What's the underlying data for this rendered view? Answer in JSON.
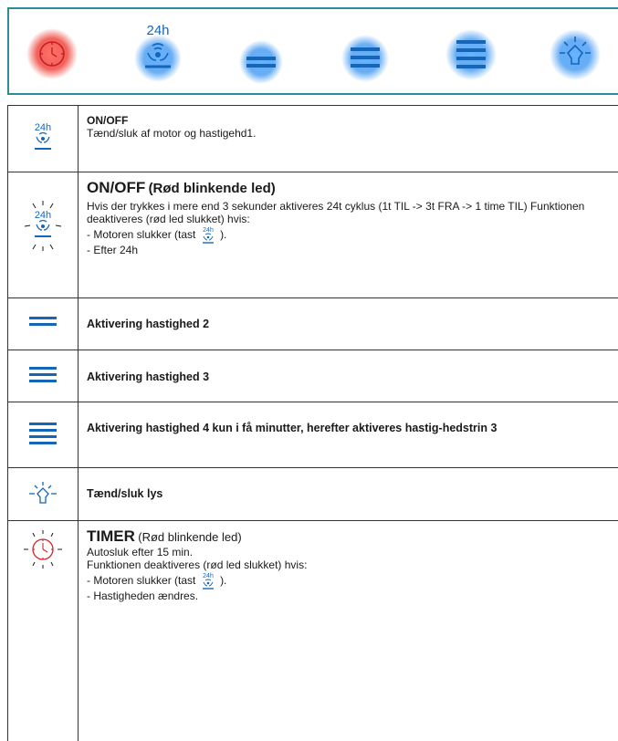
{
  "panel": {
    "buttons": [
      {
        "name": "timer-button",
        "icon": "timer-icon",
        "glow": "#e8352f"
      },
      {
        "name": "onoff-24h-button",
        "icon": "fan-24h-icon",
        "label": "24h",
        "glow": "#1e78e6"
      },
      {
        "name": "speed-2-button",
        "icon": "speed-2-bars-icon",
        "glow": "#1e78e6"
      },
      {
        "name": "speed-3-button",
        "icon": "speed-3-bars-icon",
        "glow": "#1e78e6"
      },
      {
        "name": "speed-4-button",
        "icon": "speed-4-bars-icon",
        "glow": "#1e78e6"
      },
      {
        "name": "light-button",
        "icon": "lightbulb-icon",
        "glow": "#1e78e6"
      }
    ]
  },
  "rows": {
    "onoff": {
      "icon_label": "24h",
      "title": "ON/OFF",
      "text": "Tænd/sluk af motor og hastigehd1."
    },
    "onoff_blink": {
      "icon_label": "24h",
      "title": "ON/OFF",
      "title_suffix": "(Rød blinkende led)",
      "text": "Hvis der trykkes i mere end 3 sekunder aktiveres 24t cyklus (1t TIL -> 3t FRA -> 1 time TIL) Funktionen deaktiveres (rød led slukket) hvis:",
      "line1_a": "- Motoren slukker (tast",
      "line1_b": ").",
      "line2": "- Efter 24h"
    },
    "speed2": {
      "text": "Aktivering hastighed 2"
    },
    "speed3": {
      "text": "Aktivering hastighed 3"
    },
    "speed4": {
      "text": "Aktivering hastighed 4 kun i få minutter, herefter aktiveres hastig-hedstrin 3"
    },
    "light": {
      "text": "Tænd/sluk lys"
    },
    "timer": {
      "title": "TIMER",
      "title_suffix": "(Rød blinkende led)",
      "line1": "Autosluk efter 15 min.",
      "line2": "Funktionen deaktiveres (rød led slukket) hvis:",
      "line3_a": "- Motoren slukker (tast",
      "line3_b": ").",
      "line4": "- Hastigheden ændres."
    }
  },
  "colors": {
    "icon_blue": "#1666b8",
    "icon_red": "#d8232a",
    "panel_border": "#2b8d96"
  }
}
